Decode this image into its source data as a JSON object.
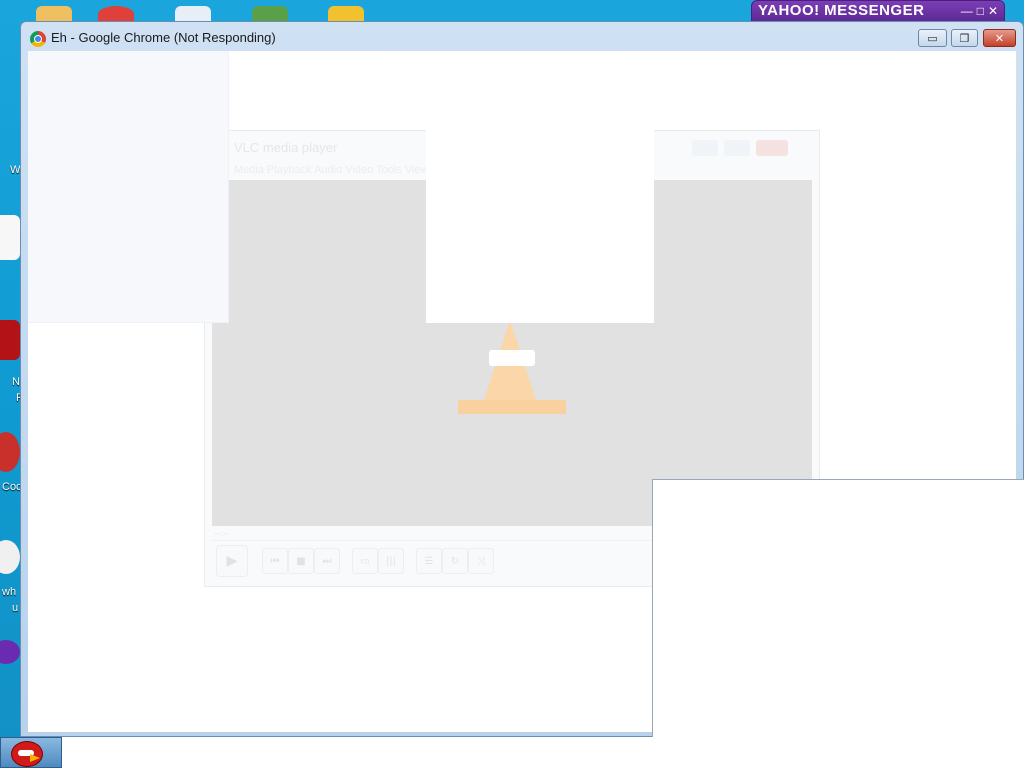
{
  "desktop": {
    "left_labels": [
      "W",
      "N",
      "F",
      "Coc",
      "wh",
      "u"
    ]
  },
  "yahoo": {
    "logo": "YAHOO!",
    "title": "MESSENGER",
    "minimize_glyph": "—",
    "maximize_glyph": "□",
    "close_glyph": "✕"
  },
  "chrome": {
    "title": "Eh - Google Chrome (Not Responding)",
    "minimize_glyph": "▭",
    "maximize_glyph": "❐",
    "close_glyph": "✕"
  },
  "vlc": {
    "title": "VLC media player",
    "menu": "Media  Playback  Audio  Video  Tools  View  Help",
    "time_label": "--:--",
    "controls": [
      "▶",
      "⏮",
      "■",
      "⏭",
      "▭",
      "|||",
      "☰",
      "↻",
      "⤨"
    ]
  },
  "colors": {
    "desktop_blue": "#16a3d8",
    "yahoo_purple": "#7c3db6",
    "chrome_frame": "#cfe1f3",
    "vlc_orange": "#f5a542"
  }
}
